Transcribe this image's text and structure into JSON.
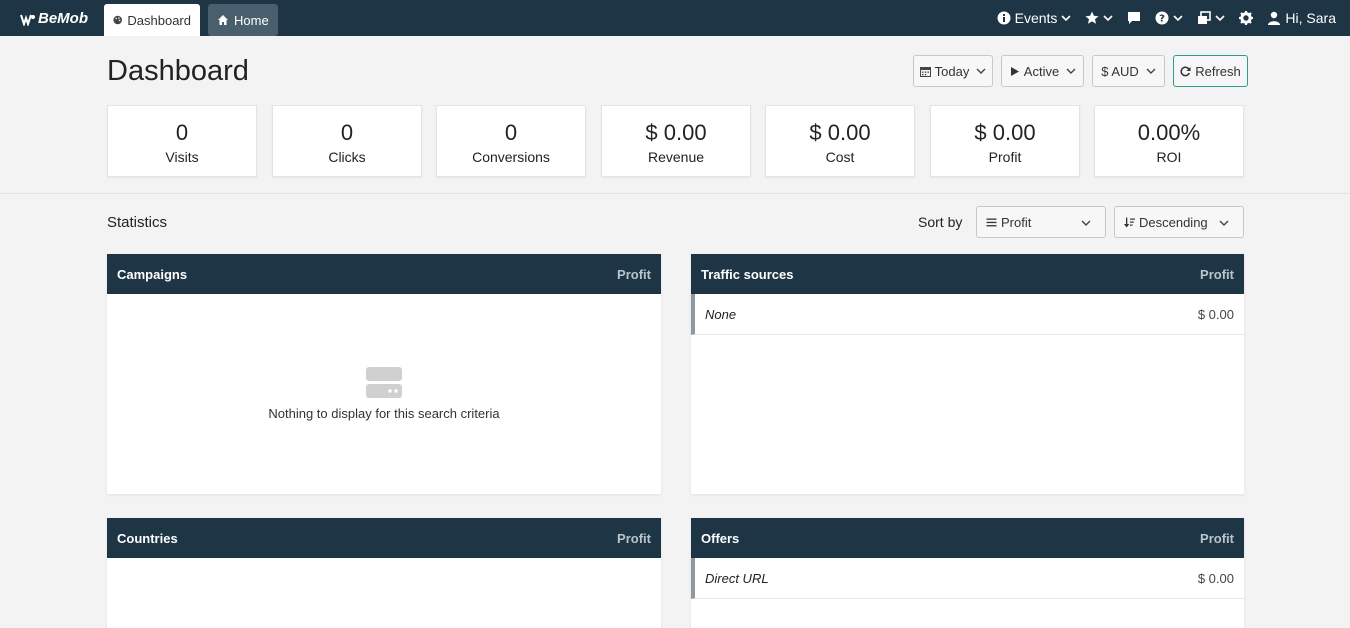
{
  "app": {
    "logo_text": "BeMob"
  },
  "tabs": [
    {
      "label": "Dashboard",
      "icon": "palette-icon"
    },
    {
      "label": "Home",
      "icon": "home-icon"
    }
  ],
  "nav": {
    "events_label": "Events",
    "user_greeting": "Hi, Sara"
  },
  "header": {
    "title": "Dashboard",
    "date_range": "Today",
    "status_filter": "Active",
    "currency": "$ AUD",
    "refresh_label": "Refresh"
  },
  "stats": [
    {
      "value": "0",
      "label": "Visits"
    },
    {
      "value": "0",
      "label": "Clicks"
    },
    {
      "value": "0",
      "label": "Conversions"
    },
    {
      "value": "$ 0.00",
      "label": "Revenue"
    },
    {
      "value": "$ 0.00",
      "label": "Cost"
    },
    {
      "value": "$ 0.00",
      "label": "Profit"
    },
    {
      "value": "0.00%",
      "label": "ROI"
    }
  ],
  "statistics": {
    "title": "Statistics",
    "sort_by_label": "Sort by",
    "sort_field": "Profit",
    "sort_order": "Descending"
  },
  "panels": {
    "campaigns": {
      "title": "Campaigns",
      "column": "Profit",
      "empty_message": "Nothing to display for this search criteria"
    },
    "traffic_sources": {
      "title": "Traffic sources",
      "column": "Profit",
      "rows": [
        {
          "name": "None",
          "value": "$ 0.00"
        }
      ]
    },
    "countries": {
      "title": "Countries",
      "column": "Profit"
    },
    "offers": {
      "title": "Offers",
      "column": "Profit",
      "rows": [
        {
          "name": "Direct URL",
          "value": "$ 0.00"
        }
      ]
    }
  },
  "colors": {
    "topbar": "#1e3545",
    "accent": "#2a9d8f",
    "background": "#f4f3f3"
  }
}
